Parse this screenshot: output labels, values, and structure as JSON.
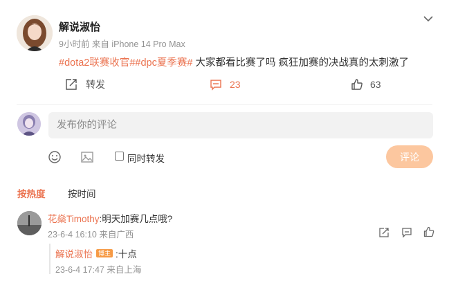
{
  "post": {
    "author": "解说淑怡",
    "meta": "9小时前  来自 iPhone 14 Pro Max",
    "hashtags": "#dota2联赛收官##dpc夏季赛#",
    "text": " 大家都看比赛了吗 疯狂加赛的决战真的太刺激了",
    "actions": {
      "repost_label": "转发",
      "comment_count": "23",
      "like_count": "63"
    }
  },
  "composer": {
    "placeholder": "发布你的评论",
    "repost_checkbox_label": "同时转发",
    "submit_label": "评论"
  },
  "sort": {
    "hot_label": "按热度",
    "time_label": "按时间"
  },
  "comments": [
    {
      "author": "花燊Timothy",
      "text": ":明天加赛几点哦?",
      "meta": "23-6-4 16:10 来自广西",
      "replies": [
        {
          "author": "解说淑怡",
          "badge": "博主",
          "text": ":十点",
          "meta": "23-6-4 17:47 来自上海"
        }
      ]
    }
  ],
  "colors": {
    "accent": "#eb7350",
    "submit_disabled": "#fcc79f",
    "muted": "#939393",
    "input_bg": "#f2f2f2"
  },
  "icons": [
    "chevron-down-icon",
    "share-icon",
    "comment-icon",
    "like-icon",
    "emoji-icon",
    "image-icon",
    "reply-icon"
  ]
}
